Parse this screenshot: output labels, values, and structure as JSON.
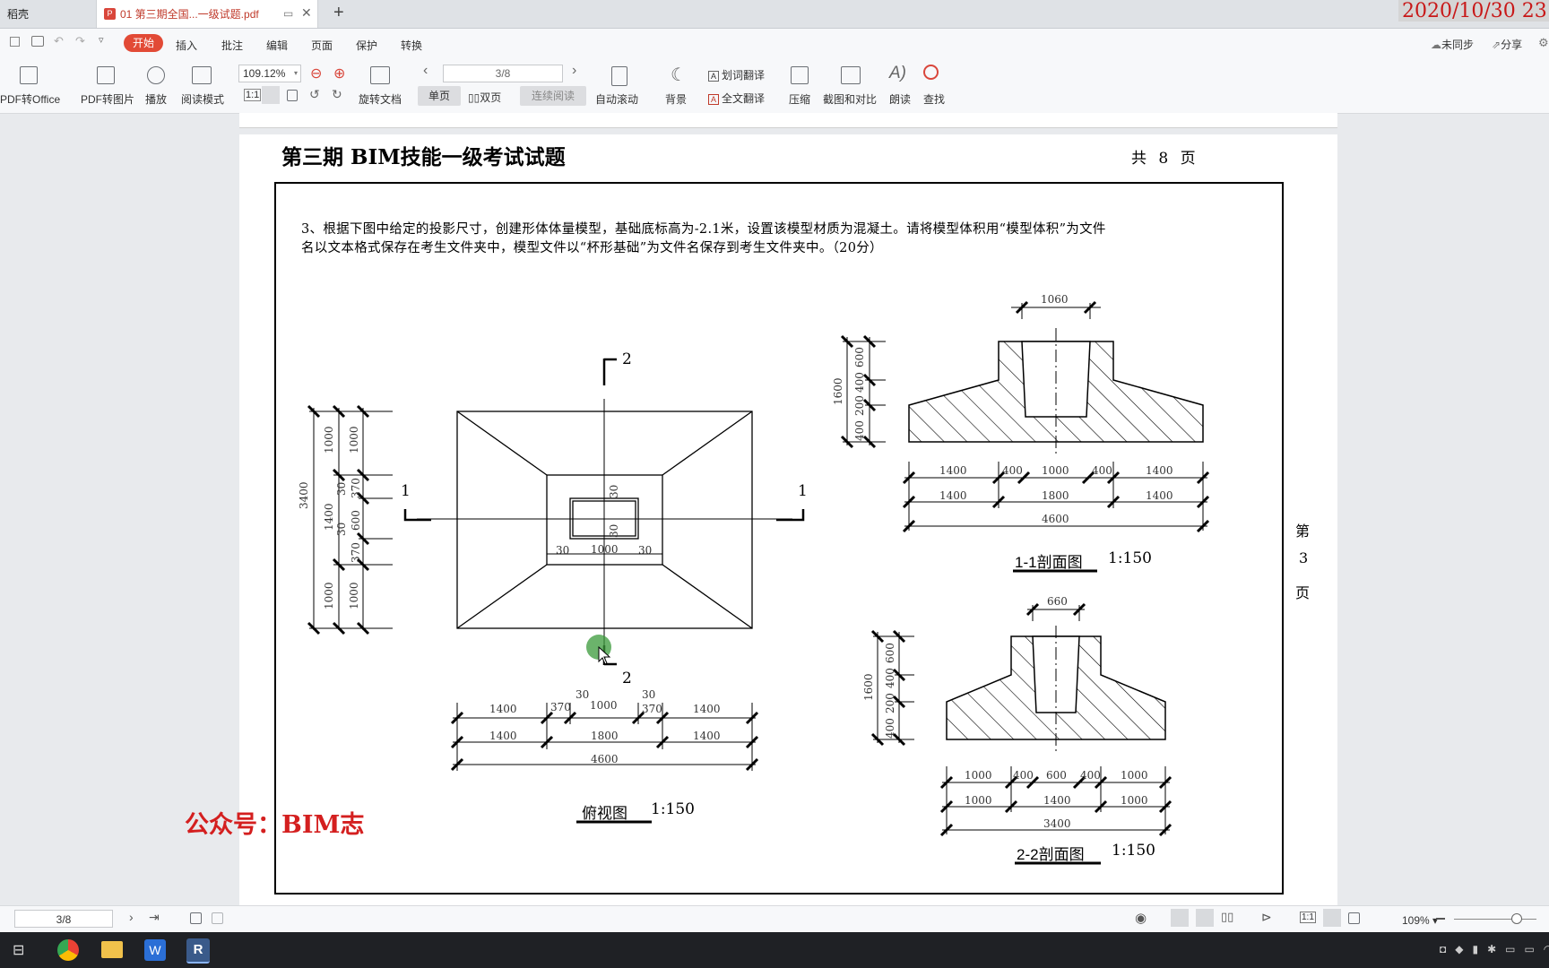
{
  "tabs": {
    "home": "稻壳",
    "pdf": "01 第三期全国...一级试题.pdf",
    "new_tab": "+"
  },
  "datestamp": "2020/10/30 23",
  "menu": {
    "start": "开始",
    "items": [
      "插入",
      "批注",
      "编辑",
      "页面",
      "保护",
      "转换"
    ],
    "sync": "未同步",
    "share": "分享"
  },
  "toolbar": {
    "pdf_to_office": "PDF转Office",
    "pdf_to_image": "PDF转图片",
    "play": "播放",
    "read_mode": "阅读模式",
    "zoom": "109.12%",
    "rotate": "旋转文档",
    "page_field": "3/8",
    "single_page": "单页",
    "double_page": "双页",
    "continuous": "连续阅读",
    "auto_scroll": "自动滚动",
    "background": "背景",
    "word_translate": "划词翻译",
    "full_translate": "全文翻译",
    "compress": "压缩",
    "screenshot_compare": "截图和对比",
    "read_aloud": "朗读",
    "find": "查找"
  },
  "document": {
    "title": "第三期 BIM技能一级考试试题",
    "page_count": "共 8 页",
    "question_line1": "3、根据下图中给定的投影尺寸，创建形体体量模型，基础底标高为-2.1米，设置该模型材质为混凝土。请将模型体积用“模型体积”为文件",
    "question_line2": "名以文本格式保存在考生文件夹中，模型文件以“杯形基础”为文件名保存到考生文件夹中。（20分）",
    "side_page": [
      "第",
      "3",
      "页"
    ],
    "watermark": "公众号：BIM志",
    "plan": {
      "caption_name": "俯视图",
      "caption_scale": "1:150",
      "section_marks": [
        "1",
        "1",
        "2",
        "2"
      ],
      "left_dims_outer": [
        "3400"
      ],
      "left_dims_mid": [
        "1000",
        "1400",
        "1000"
      ],
      "left_dims_inner": [
        "1000",
        "370",
        "30",
        "600",
        "30",
        "370",
        "1000"
      ],
      "inner_dims": [
        "30",
        "30",
        "30",
        "1000",
        "30"
      ],
      "bottom_row1": [
        "1400",
        "370",
        "30",
        "1000",
        "30",
        "370",
        "1400"
      ],
      "bottom_row2": [
        "1400",
        "1800",
        "1400"
      ],
      "bottom_row3": [
        "4600"
      ]
    },
    "section1": {
      "caption_name": "1-1剖面图",
      "caption_scale": "1:150",
      "top_dim": "1060",
      "left_outer": "1600",
      "left_inner": [
        "600",
        "400",
        "200",
        "400"
      ],
      "row1": [
        "1400",
        "400",
        "1000",
        "400",
        "1400"
      ],
      "row2": [
        "1400",
        "1800",
        "1400"
      ],
      "row3": [
        "4600"
      ]
    },
    "section2": {
      "caption_name": "2-2剖面图",
      "caption_scale": "1:150",
      "top_dim": "660",
      "left_outer": "1600",
      "left_inner": [
        "600",
        "400",
        "200",
        "400"
      ],
      "row1": [
        "1000",
        "400",
        "600",
        "400",
        "1000"
      ],
      "row2": [
        "1000",
        "1400",
        "1000"
      ],
      "row3": [
        "3400"
      ]
    }
  },
  "status": {
    "page": "3/8",
    "zoom": "109%"
  }
}
